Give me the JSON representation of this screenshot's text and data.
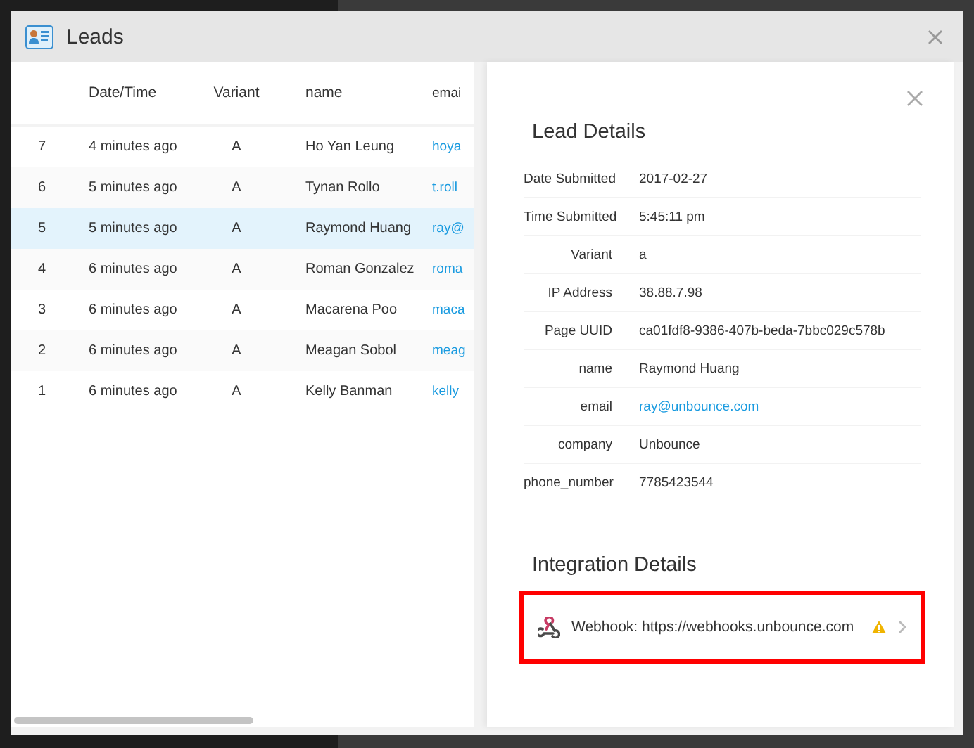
{
  "window": {
    "title": "Leads"
  },
  "table": {
    "columns": [
      "Date/Time",
      "Variant",
      "name",
      "emai"
    ],
    "rows": [
      {
        "number": "7",
        "date_time": "4 minutes ago",
        "variant": "A",
        "name": "Ho Yan Leung",
        "email": "hoya",
        "selected": false
      },
      {
        "number": "6",
        "date_time": "5 minutes ago",
        "variant": "A",
        "name": "Tynan Rollo",
        "email": "t.roll",
        "selected": false
      },
      {
        "number": "5",
        "date_time": "5 minutes ago",
        "variant": "A",
        "name": "Raymond Huang",
        "email": "ray@",
        "selected": true
      },
      {
        "number": "4",
        "date_time": "6 minutes ago",
        "variant": "A",
        "name": "Roman Gonzalez",
        "email": "roma",
        "selected": false
      },
      {
        "number": "3",
        "date_time": "6 minutes ago",
        "variant": "A",
        "name": "Macarena Poo",
        "email": "maca",
        "selected": false
      },
      {
        "number": "2",
        "date_time": "6 minutes ago",
        "variant": "A",
        "name": "Meagan Sobol",
        "email": "meag",
        "selected": false
      },
      {
        "number": "1",
        "date_time": "6 minutes ago",
        "variant": "A",
        "name": "Kelly Banman",
        "email": "kelly",
        "selected": false
      }
    ]
  },
  "details": {
    "title": "Lead Details",
    "fields": [
      {
        "label": "Date Submitted",
        "value": "2017-02-27",
        "kind": "text"
      },
      {
        "label": "Time Submitted",
        "value": "5:45:11 pm",
        "kind": "text"
      },
      {
        "label": "Variant",
        "value": "a",
        "kind": "text"
      },
      {
        "label": "IP Address",
        "value": "38.88.7.98",
        "kind": "text"
      },
      {
        "label": "Page UUID",
        "value": "ca01fdf8-9386-407b-beda-7bbc029c578b",
        "kind": "text"
      },
      {
        "label": "name",
        "value": "Raymond Huang",
        "kind": "text"
      },
      {
        "label": "email",
        "value": "ray@unbounce.com",
        "kind": "link"
      },
      {
        "label": "company",
        "value": "Unbounce",
        "kind": "text"
      },
      {
        "label": "phone_number",
        "value": "7785423544",
        "kind": "text"
      }
    ]
  },
  "integrations": {
    "title": "Integration Details",
    "items": [
      {
        "label": "Webhook: https://webhooks.unbounce.com",
        "warning": true,
        "highlighted": true
      }
    ]
  }
}
